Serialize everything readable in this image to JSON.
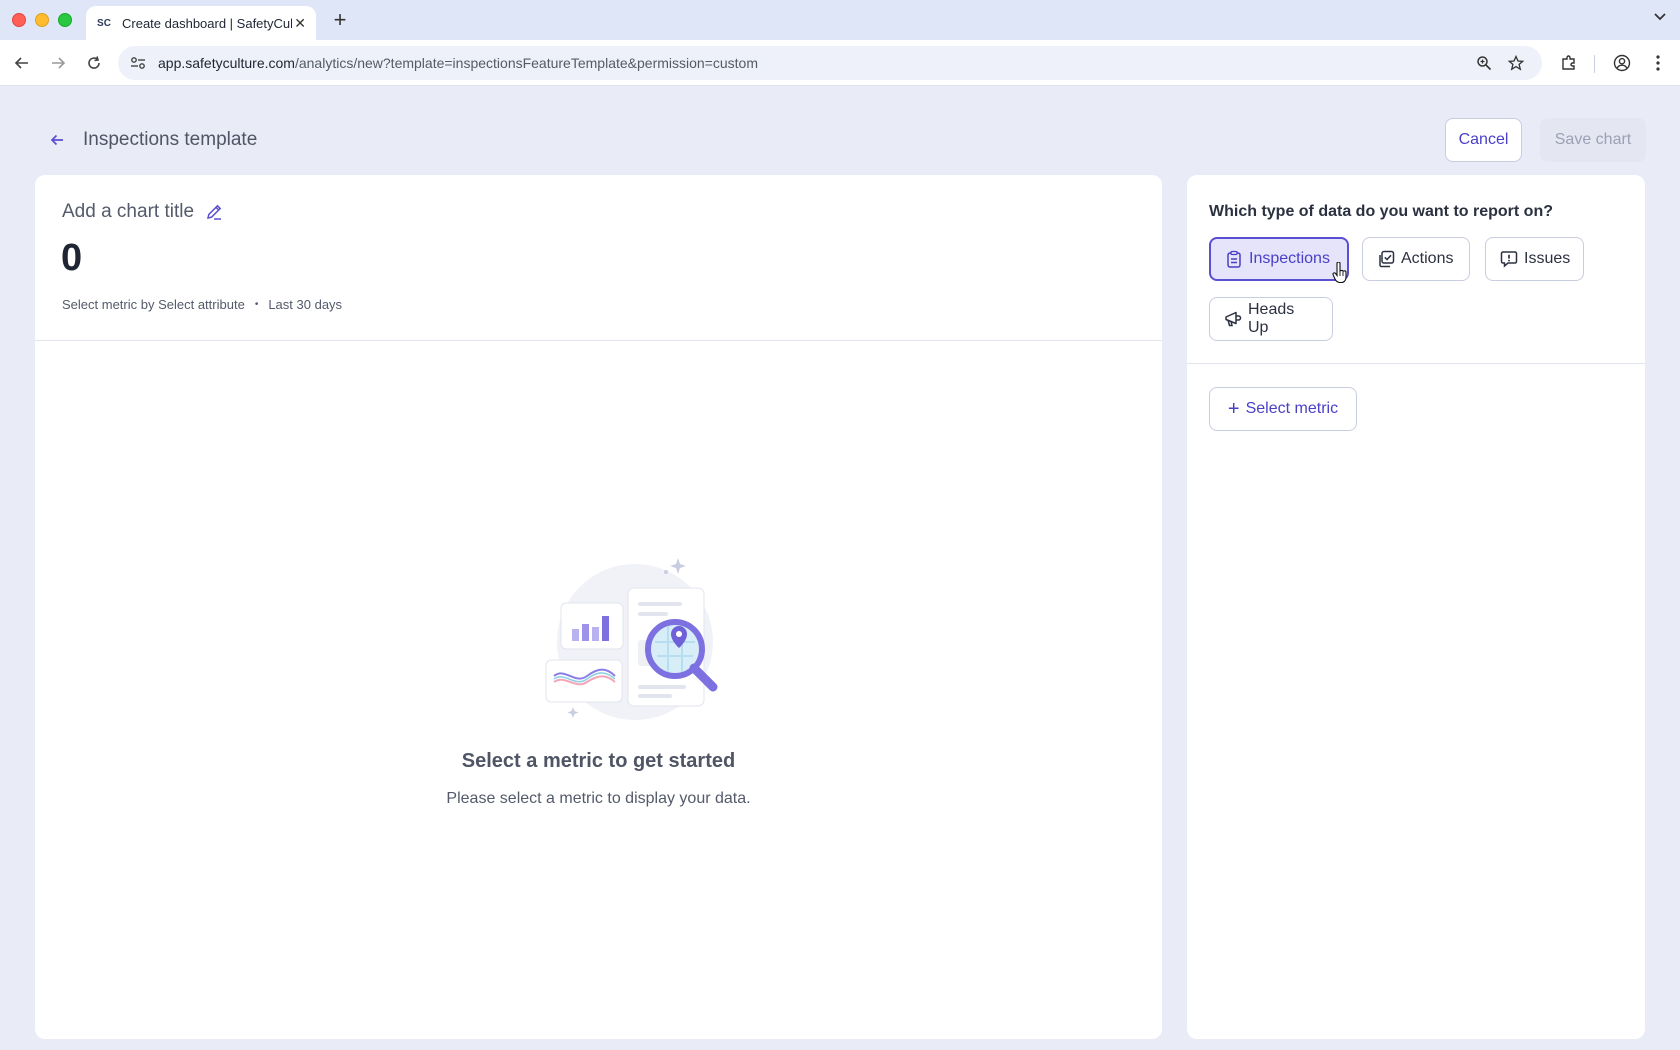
{
  "browser": {
    "tab_title": "Create dashboard | SafetyCulture",
    "favicon_text": "SC",
    "url_host": "app.safetyculture.com",
    "url_path": "/analytics/new?template=inspectionsFeatureTemplate&permission=custom"
  },
  "header": {
    "title": "Inspections template",
    "cancel_label": "Cancel",
    "save_label": "Save chart"
  },
  "chart": {
    "title_placeholder": "Add a chart title",
    "value": "0",
    "metric_text": "Select metric by Select attribute",
    "separator": "•",
    "range_text": "Last 30 days",
    "empty_title": "Select a metric to get started",
    "empty_text": "Please select a metric to display your data."
  },
  "panel": {
    "question": "Which type of data do you want to report on?",
    "data_types": [
      {
        "label": "Inspections",
        "icon": "clipboard-icon",
        "selected": true
      },
      {
        "label": "Actions",
        "icon": "checked-squares-icon",
        "selected": false
      },
      {
        "label": "Issues",
        "icon": "alert-speech-icon",
        "selected": false
      },
      {
        "label": "Heads Up",
        "icon": "megaphone-icon",
        "selected": false
      }
    ],
    "select_metric_label": "Select metric"
  },
  "colors": {
    "accent": "#5b4fd1",
    "page_bg": "#e9ecf7",
    "selected_chip_bg": "#e6e4fb"
  }
}
